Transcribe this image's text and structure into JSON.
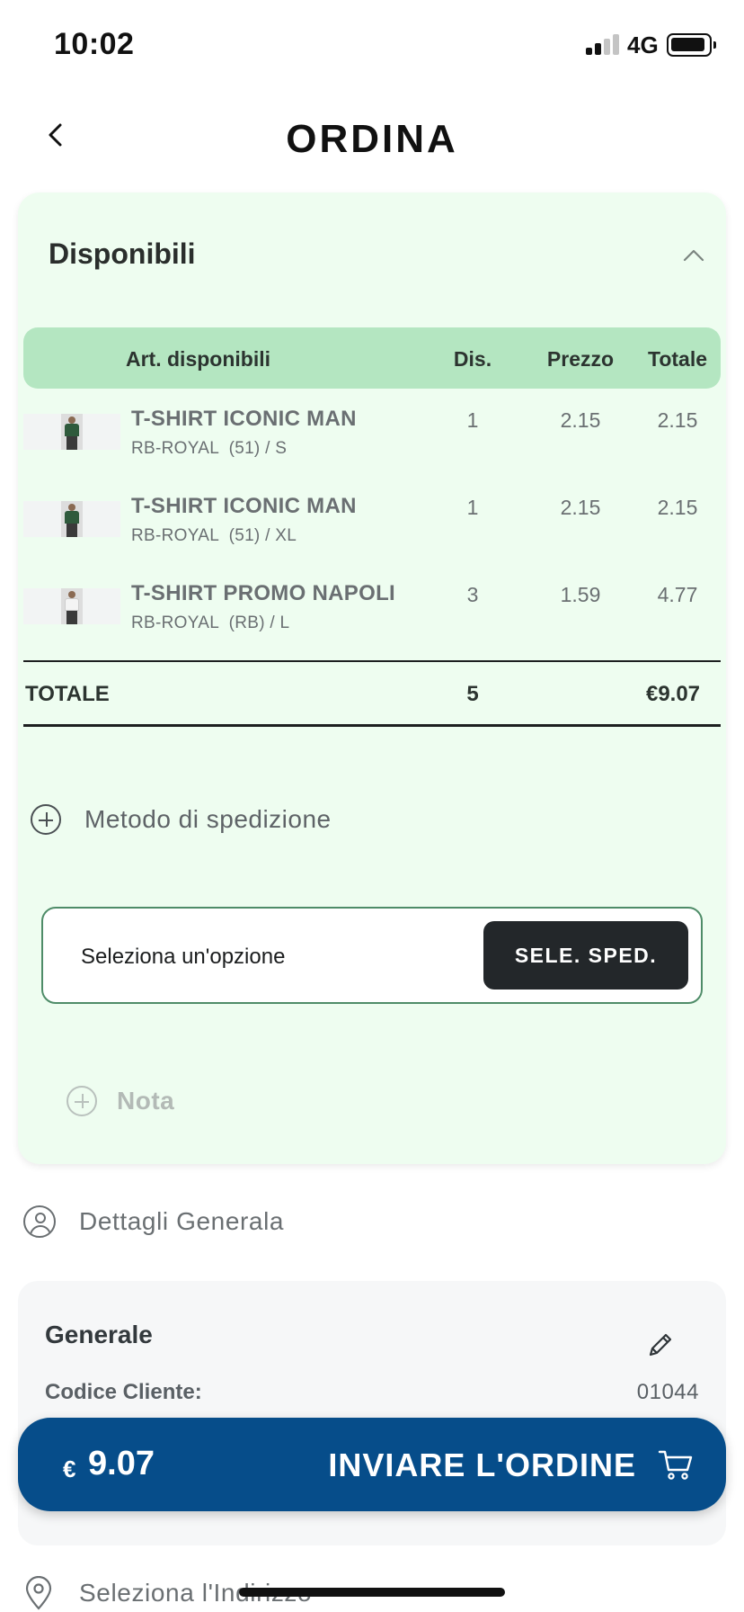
{
  "status_bar": {
    "time": "10:02",
    "network": "4G"
  },
  "header": {
    "title": "ORDINA"
  },
  "available": {
    "section_title": "Disponibili",
    "columns": {
      "article": "Art. disponibili",
      "dis": "Dis.",
      "price": "Prezzo",
      "total": "Totale"
    },
    "items": [
      {
        "name": "T-SHIRT ICONIC MAN",
        "variant": "RB-ROYAL  (51) / S",
        "dis": "1",
        "price": "2.15",
        "total": "2.15",
        "shirt_color": "#2f5a3c"
      },
      {
        "name": "T-SHIRT ICONIC MAN",
        "variant": "RB-ROYAL  (51) / XL",
        "dis": "1",
        "price": "2.15",
        "total": "2.15",
        "shirt_color": "#2f5a3c"
      },
      {
        "name": "T-SHIRT PROMO NAPOLI",
        "variant": "RB-ROYAL  (RB) / L",
        "dis": "3",
        "price": "1.59",
        "total": "4.77",
        "shirt_color": "#f4f4f4"
      }
    ],
    "totals": {
      "label": "TOTALE",
      "qty": "5",
      "amount": "€9.07"
    }
  },
  "shipping": {
    "section_label": "Metodo di spedizione",
    "placeholder": "Seleziona un'opzione",
    "button": "SELE. SPED."
  },
  "note": {
    "label": "Nota"
  },
  "details": {
    "label": "Dettagli Generala"
  },
  "general": {
    "title": "Generale",
    "client_code_label": "Codice Cliente:",
    "client_code_value": "01044"
  },
  "address": {
    "label": "Seleziona l'Indirizzo"
  },
  "order_bar": {
    "currency": "€",
    "amount": "9.07",
    "action": "INVIARE L'ORDINE"
  },
  "colors": {
    "card_bg": "#eefdf0",
    "table_head": "#b4e6c1",
    "order_bar": "#064d8a",
    "ship_border": "#4e8c68"
  }
}
